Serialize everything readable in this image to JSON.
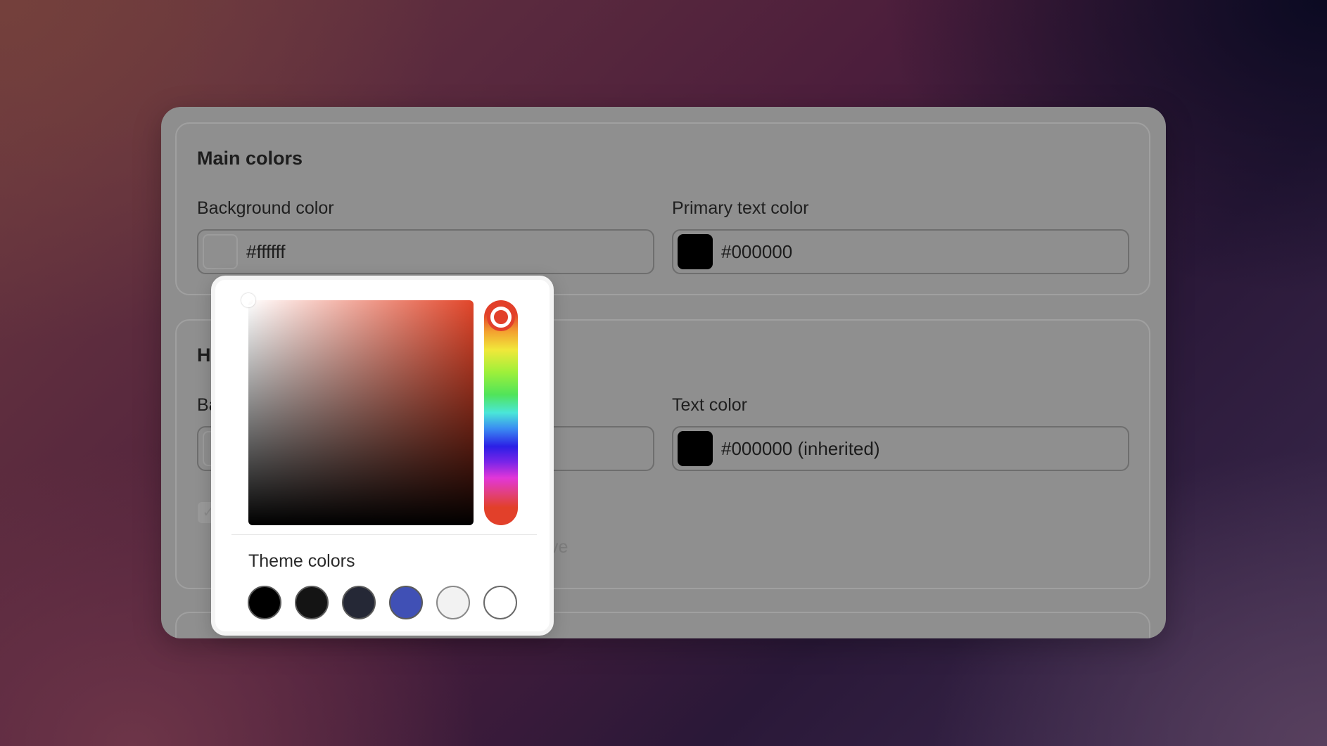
{
  "main_colors": {
    "title": "Main colors",
    "background": {
      "label": "Background color",
      "value": "#ffffff",
      "swatch": "#8f8f8f"
    },
    "primary_text": {
      "label": "Primary text color",
      "value": "#000000",
      "swatch": "#000000"
    }
  },
  "header_section": {
    "title_partial": "He",
    "background_label_partial": "Ba",
    "text_color": {
      "label": "Text color",
      "value": "#000000 (inherited)",
      "swatch": "#000000"
    },
    "checkbox_checked": true,
    "helper_text_partial": "ve"
  },
  "color_picker": {
    "hue_color": "#e2402a",
    "theme_label": "Theme colors",
    "theme_colors": [
      {
        "name": "black",
        "color": "#000000"
      },
      {
        "name": "near-black",
        "color": "#141414"
      },
      {
        "name": "dark-navy",
        "color": "#252836"
      },
      {
        "name": "indigo",
        "color": "#4050b5"
      },
      {
        "name": "light-gray",
        "color": "#f2f2f2"
      },
      {
        "name": "white",
        "color": "#ffffff"
      }
    ]
  }
}
